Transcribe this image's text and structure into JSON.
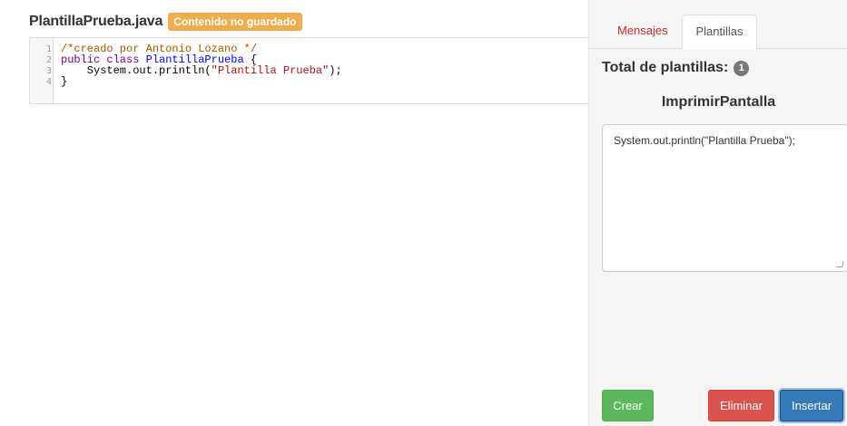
{
  "editor": {
    "file_name": "PlantillaPrueba.java",
    "status_badge": "Contenido no guardado",
    "lines": [
      {
        "number": "1",
        "tokens": [
          {
            "t": "comment",
            "text": "/*creado por Antonio Lozano */"
          }
        ]
      },
      {
        "number": "2",
        "tokens": [
          {
            "t": "keyword",
            "text": "public class "
          },
          {
            "t": "def",
            "text": "PlantillaPrueba"
          },
          {
            "t": "plain",
            "text": " {"
          }
        ]
      },
      {
        "number": "3",
        "tokens": [
          {
            "t": "plain",
            "text": "    System.out.println("
          },
          {
            "t": "string",
            "text": "\"Plantilla Prueba\""
          },
          {
            "t": "plain",
            "text": ");"
          }
        ]
      },
      {
        "number": "4",
        "tokens": [
          {
            "t": "plain",
            "text": "}"
          }
        ]
      }
    ]
  },
  "panel": {
    "tabs": {
      "mensajes": "Mensajes",
      "plantillas": "Plantillas"
    },
    "total_label": "Total de plantillas:",
    "total_count": "1",
    "template_title": "ImprimirPantalla",
    "template_body": "System.out.println(\"Plantilla Prueba\");",
    "buttons": {
      "crear": "Crear",
      "eliminar": "Eliminar",
      "insertar": "Insertar"
    }
  },
  "colors": {
    "unsaved_badge": "#f0ad4e",
    "active_tab_text": "#c9302c",
    "crear": "#5cb85c",
    "eliminar": "#d9534f",
    "insertar": "#337ab7"
  }
}
